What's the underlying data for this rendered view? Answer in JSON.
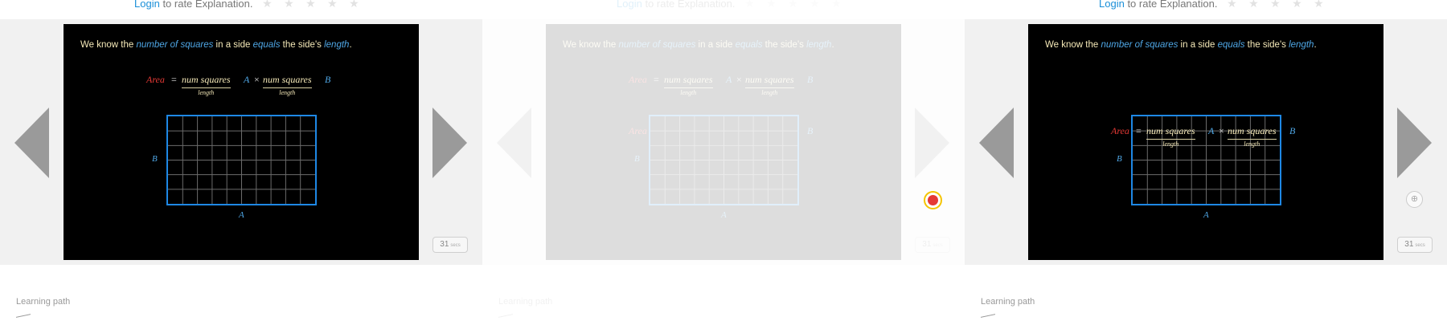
{
  "rating": {
    "login_link": "Login",
    "text": "to rate Explanation.",
    "stars": "★ ★ ★ ★ ★"
  },
  "slide": {
    "intro_parts": [
      "We know the ",
      "number of squares",
      " in a side ",
      "equals",
      " the side's ",
      "length",
      "."
    ],
    "formula": {
      "area": "Area",
      "equals": "=",
      "numerator": "num squares",
      "denominator": "length",
      "a": "A",
      "times": "×",
      "b": "B"
    },
    "grid": {
      "columns": 10,
      "rows": 6
    },
    "label_a": "A",
    "label_b": "B"
  },
  "counter": {
    "value": "31",
    "unit": "secs"
  },
  "learning_path": "Learning path",
  "colors": {
    "slide_bg": "#000000",
    "accent_blue": "#1e88e5",
    "area_red": "#e53935",
    "cream_text": "#f5e9b8",
    "arrow_gray": "#9a9a9a"
  },
  "icons": {
    "prev": "triangle-left-icon",
    "next": "triangle-right-icon",
    "target": "crosshair-icon"
  }
}
